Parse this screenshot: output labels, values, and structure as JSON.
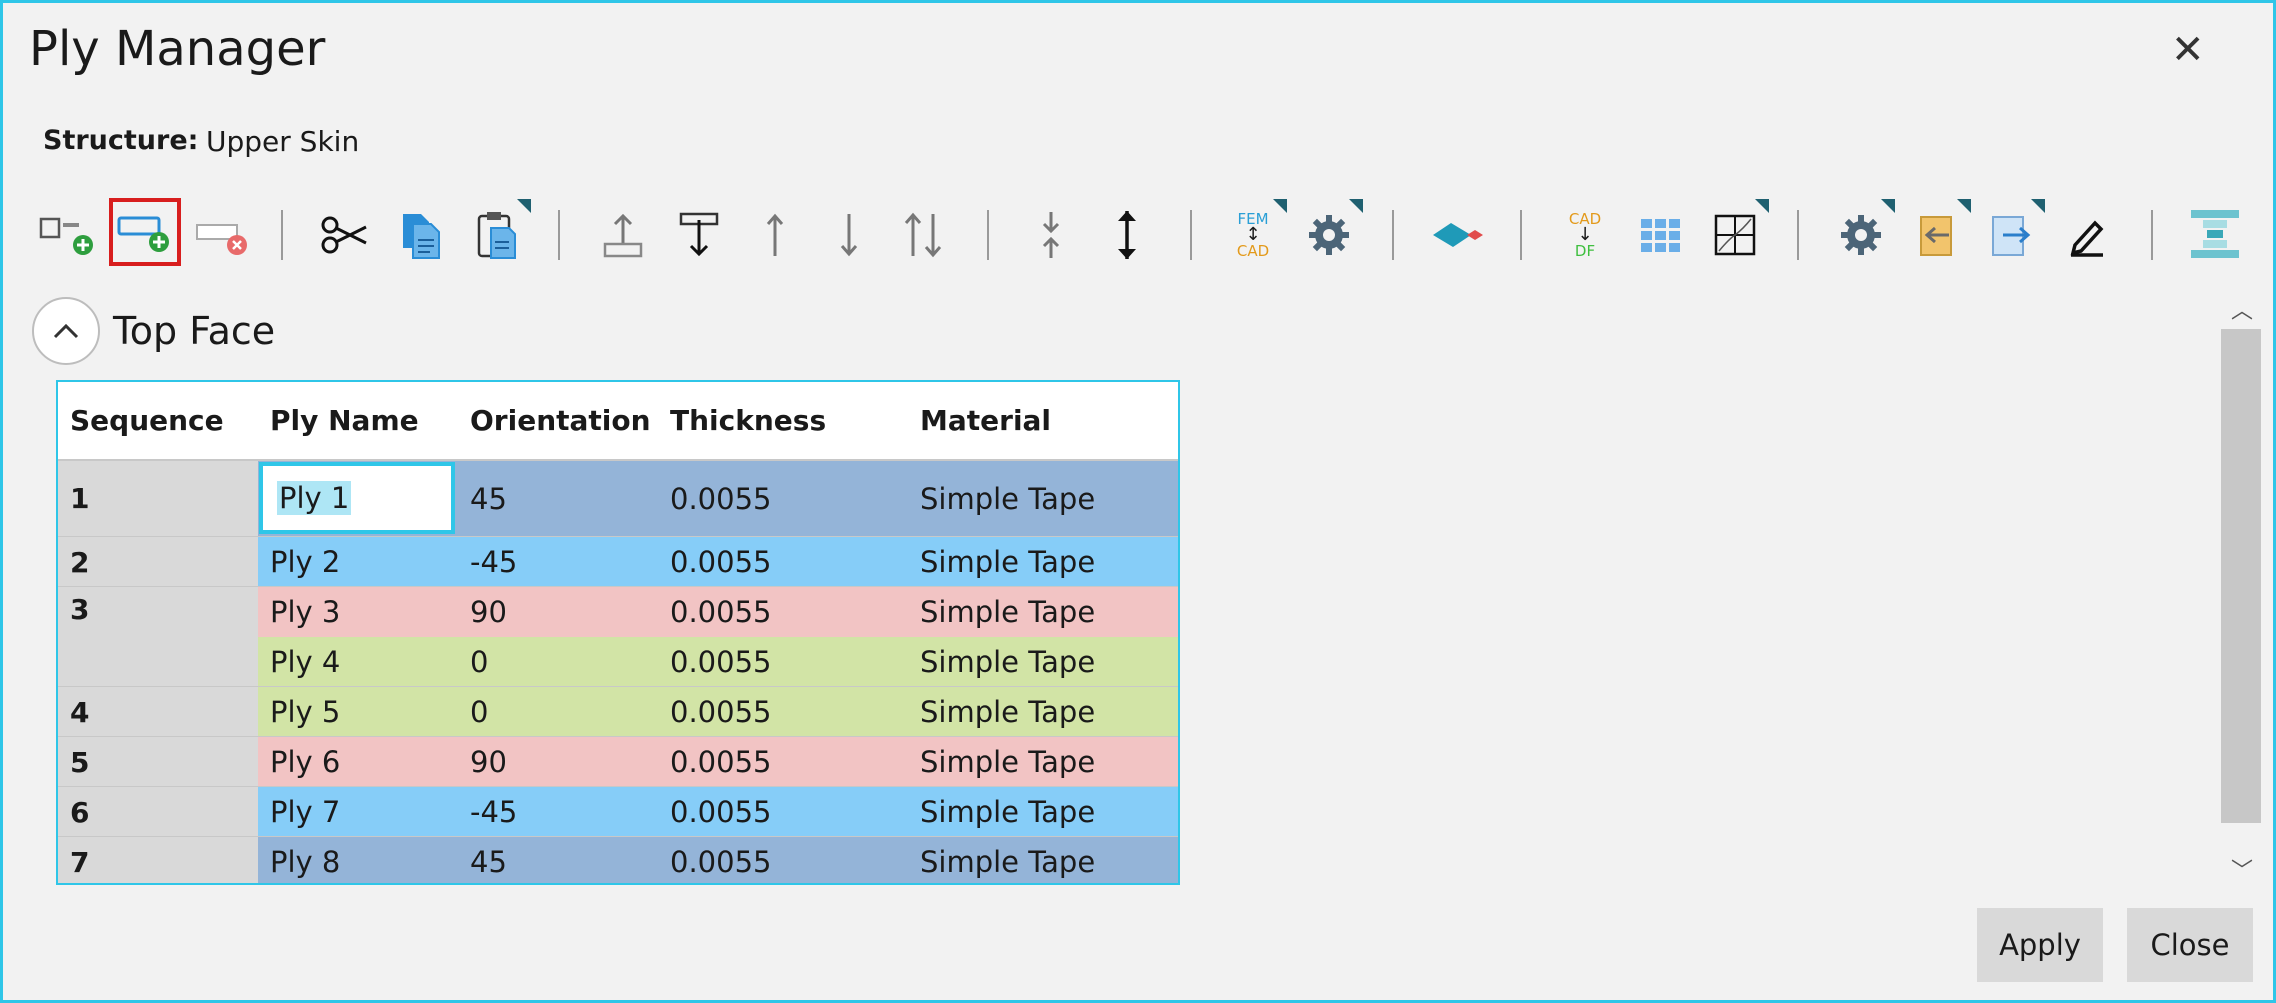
{
  "window": {
    "title": "Ply Manager",
    "close_glyph": "✕"
  },
  "structure": {
    "label": "Structure:",
    "value": "Upper Skin"
  },
  "toolbar": {
    "icons": [
      "add-structure-icon",
      "add-ply-icon",
      "remove-ply-icon",
      "cut-icon",
      "copy-icon",
      "paste-icon",
      "move-top-icon",
      "move-bottom-icon",
      "move-up-icon",
      "move-down-icon",
      "swap-icon",
      "collapse-icon",
      "expand-icon",
      "fem-cad-icon",
      "settings-icon",
      "surface-icon",
      "cad-df-icon",
      "grid-icon",
      "cross-section-icon",
      "config-icon",
      "import-icon",
      "export-icon",
      "edit-icon",
      "layup-icon"
    ],
    "fem_top": "FEM",
    "fem_bottom": "CAD",
    "cad_top": "CAD",
    "cad_bottom": "DF"
  },
  "section": {
    "title": "Top Face"
  },
  "table": {
    "columns": [
      "Sequence",
      "Ply Name",
      "Orientation",
      "Thickness",
      "Material"
    ],
    "rows": [
      {
        "seq": "1",
        "ply": "Ply 1",
        "orientation": "45",
        "thickness": "0.0055",
        "material": "Simple Tape",
        "color": "#94b4d8"
      },
      {
        "seq": "2",
        "ply": "Ply 2",
        "orientation": "-45",
        "thickness": "0.0055",
        "material": "Simple Tape",
        "color": "#86cdf8"
      },
      {
        "seq": "3",
        "ply": "Ply 3",
        "orientation": "90",
        "thickness": "0.0055",
        "material": "Simple Tape",
        "color": "#f2c4c4"
      },
      {
        "seq": "",
        "ply": "Ply 4",
        "orientation": "0",
        "thickness": "0.0055",
        "material": "Simple Tape",
        "color": "#d2e4a6"
      },
      {
        "seq": "4",
        "ply": "Ply 5",
        "orientation": "0",
        "thickness": "0.0055",
        "material": "Simple Tape",
        "color": "#d2e4a6"
      },
      {
        "seq": "5",
        "ply": "Ply 6",
        "orientation": "90",
        "thickness": "0.0055",
        "material": "Simple Tape",
        "color": "#f2c4c4"
      },
      {
        "seq": "6",
        "ply": "Ply 7",
        "orientation": "-45",
        "thickness": "0.0055",
        "material": "Simple Tape",
        "color": "#86cdf8"
      },
      {
        "seq": "7",
        "ply": "Ply 8",
        "orientation": "45",
        "thickness": "0.0055",
        "material": "Simple Tape",
        "color": "#94b4d8"
      }
    ]
  },
  "scroll": {
    "up_glyph": "︿",
    "down_glyph": "﹀"
  },
  "buttons": {
    "apply": "Apply",
    "close": "Close"
  },
  "colors": {
    "accent": "#2fc6e8",
    "highlight": "#d81e1e"
  }
}
